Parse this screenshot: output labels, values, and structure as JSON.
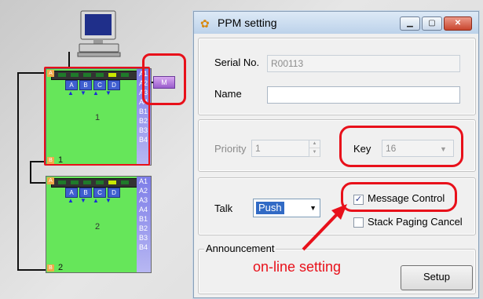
{
  "topology": {
    "units": [
      {
        "id": "1",
        "side_labels": [
          "A1",
          "A2",
          "A3",
          "A4",
          "B1",
          "B2",
          "B3",
          "B4"
        ],
        "button_labels": [
          "A",
          "B",
          "C",
          "D"
        ],
        "corner_top": "A",
        "corner_bottom": "B"
      },
      {
        "id": "2",
        "side_labels": [
          "A1",
          "A2",
          "A3",
          "A4",
          "B1",
          "B2",
          "B3",
          "B4"
        ],
        "button_labels": [
          "A",
          "B",
          "C",
          "D"
        ],
        "corner_top": "A",
        "corner_bottom": "B"
      }
    ],
    "message_button_label": "M"
  },
  "dialog": {
    "title": "PPM setting",
    "serial_label": "Serial No.",
    "serial_value": "R00113",
    "name_label": "Name",
    "name_value": "",
    "priority_label": "Priority",
    "priority_value": "1",
    "key_label": "Key",
    "key_value": "16",
    "talk_label": "Talk",
    "talk_value": "Push",
    "message_control_label": "Message Control",
    "message_control_checked": true,
    "stack_paging_label": "Stack Paging Cancel",
    "stack_paging_checked": false,
    "announcement_label": "Announcement",
    "setup_label": "Setup"
  },
  "annotation": {
    "note": "on-line setting",
    "color": "#e8101a"
  },
  "colors": {
    "unit_green": "#66e65a",
    "highlight_red": "#e8101a",
    "selection_blue": "#316ac5"
  }
}
